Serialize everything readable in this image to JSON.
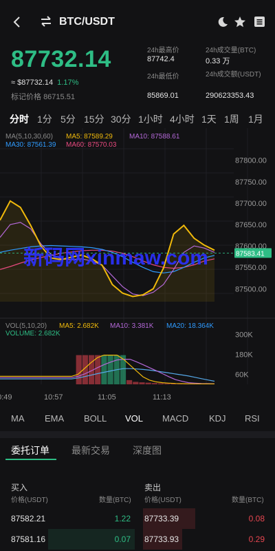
{
  "header": {
    "pair": "BTC/USDT"
  },
  "ticker": {
    "last_price": "87732.14",
    "fiat_price": "≈ $87732.14",
    "change_pct": "1.17%",
    "mark_label": "标记价格",
    "mark_price": "86715.51",
    "high_label": "24h最高价",
    "high_value": "87742.4",
    "vol_btc_label": "24h成交量(BTC)",
    "vol_btc_value": "0.33 万",
    "low_label": "24h最低价",
    "low_value": "85869.01",
    "vol_usdt_label": "24h成交额(USDT)",
    "vol_usdt_value": "290623353.43"
  },
  "timeframes": [
    "分时",
    "1分",
    "5分",
    "15分",
    "30分",
    "1小时",
    "4小时",
    "1天",
    "1周",
    "1月"
  ],
  "active_timeframe": "分时",
  "ma_legend": {
    "title": "MA(5,10,30,60)",
    "ma5": "MA5: 87589.29",
    "ma10": "MA10: 87588.61",
    "ma30": "MA30: 87561.39",
    "ma60": "MA60: 87570.03"
  },
  "vol_legend": {
    "title": "VOL(5,10,20)",
    "ma5": "MA5: 2.682K",
    "ma10": "MA10: 3.381K",
    "ma20": "MA20: 18.364K",
    "volume": "VOLUME: 2.682K"
  },
  "colors": {
    "up": "#2ebd85",
    "down": "#e64650",
    "ma5": "#f0b90b",
    "ma10": "#b468d8",
    "ma30": "#2f9bff",
    "ma60": "#e84a7f",
    "volume_line": "#55a8e8",
    "watermark": "#2b32ff"
  },
  "chart_data": [
    {
      "type": "line",
      "yaxis_ticks": [
        "87800.00",
        "87750.00",
        "87700.00",
        "87650.00",
        "87600.00",
        "87550.00",
        "87500.00"
      ],
      "ylim": [
        87470,
        87830
      ],
      "current_price_label": "87583.41",
      "current_price": 87583.41,
      "series": [
        {
          "name": "MA5",
          "values": [
            87660,
            87705,
            87690,
            87648,
            87600,
            87572,
            87568,
            87574,
            87579,
            87570,
            87555,
            87510,
            87490,
            87482,
            87486,
            87500,
            87548,
            87628,
            87648,
            87618,
            87602,
            87590
          ]
        },
        {
          "name": "MA10",
          "values": [
            87620,
            87650,
            87655,
            87640,
            87605,
            87580,
            87570,
            87568,
            87570,
            87565,
            87555,
            87530,
            87505,
            87488,
            87484,
            87492,
            87510,
            87545,
            87585,
            87600,
            87595,
            87585
          ]
        },
        {
          "name": "MA30",
          "values": [
            87585,
            87590,
            87594,
            87598,
            87600,
            87601,
            87600,
            87599,
            87598,
            87596,
            87592,
            87585,
            87575,
            87562,
            87550,
            87540,
            87537,
            87540,
            87550,
            87562,
            87572,
            87578
          ]
        },
        {
          "name": "MA60",
          "values": [
            87545,
            87552,
            87560,
            87567,
            87573,
            87578,
            87583,
            87586,
            87589,
            87590,
            87590,
            87588,
            87583,
            87575,
            87565,
            87556,
            87550,
            87548,
            87550,
            87556,
            87565,
            87570
          ]
        }
      ]
    },
    {
      "type": "bar",
      "yaxis_ticks": [
        "300K",
        "180K",
        "60K"
      ],
      "ylim": [
        0,
        330000
      ],
      "xaxis_ticks": [
        "10:49",
        "10:57",
        "11:05",
        "11:13"
      ],
      "volume_values": [
        0,
        0,
        0,
        0,
        0,
        0,
        0,
        0,
        0,
        0,
        0,
        0,
        175000,
        175000,
        175000,
        175000,
        175000,
        175000,
        175000,
        175000,
        25000,
        15000,
        12000,
        10000,
        8000,
        6000,
        5000,
        4000,
        3000,
        2500,
        2500,
        2500,
        2500,
        2500
      ],
      "ma5_values": [
        48000,
        48000,
        48000,
        48000,
        48000,
        48000,
        48000,
        48000,
        48000,
        48000,
        48000,
        48000,
        60000,
        95000,
        130000,
        160000,
        175000,
        175000,
        175000,
        150000,
        115000,
        80000,
        45000,
        25000,
        15000,
        10000,
        7000,
        5000,
        4000,
        3500,
        3000,
        2800,
        2700,
        2682
      ],
      "ma10_values": [
        40000,
        40000,
        40000,
        40000,
        40000,
        40000,
        40000,
        40000,
        40000,
        40000,
        40000,
        40000,
        48000,
        62000,
        80000,
        100000,
        118000,
        133000,
        146000,
        150000,
        150000,
        135000,
        118000,
        100000,
        82000,
        64000,
        45000,
        28000,
        18000,
        10000,
        7000,
        5000,
        4000,
        3381
      ],
      "ma20_values": [
        32000,
        32000,
        32000,
        32000,
        32000,
        32000,
        32000,
        32000,
        32000,
        32000,
        32000,
        32000,
        38000,
        46000,
        55000,
        64000,
        72000,
        80000,
        88000,
        94000,
        94000,
        92000,
        89000,
        85000,
        80000,
        74000,
        68000,
        62000,
        56000,
        50000,
        42000,
        34000,
        26000,
        18364
      ]
    }
  ],
  "indicators": [
    "MA",
    "EMA",
    "BOLL",
    "VOL",
    "MACD",
    "KDJ",
    "RSI"
  ],
  "active_indicator": "VOL",
  "tabs": [
    "委托订单",
    "最新交易",
    "深度图"
  ],
  "active_tab": "委托订单",
  "orderbook": {
    "buy_label": "买入",
    "sell_label": "卖出",
    "price_col": "价格(USDT)",
    "qty_col": "数量(BTC)",
    "rows": [
      {
        "bid_price": "87582.21",
        "bid_qty": "1.22",
        "bid_depth": 0.0,
        "ask_price": "87733.39",
        "ask_qty": "0.08",
        "ask_depth": 0.4
      },
      {
        "bid_price": "87581.16",
        "bid_qty": "0.07",
        "bid_depth": 0.7,
        "ask_price": "87733.93",
        "ask_qty": "0.29",
        "ask_depth": 0.3
      }
    ]
  },
  "watermark": "新码网xinmaw.com"
}
